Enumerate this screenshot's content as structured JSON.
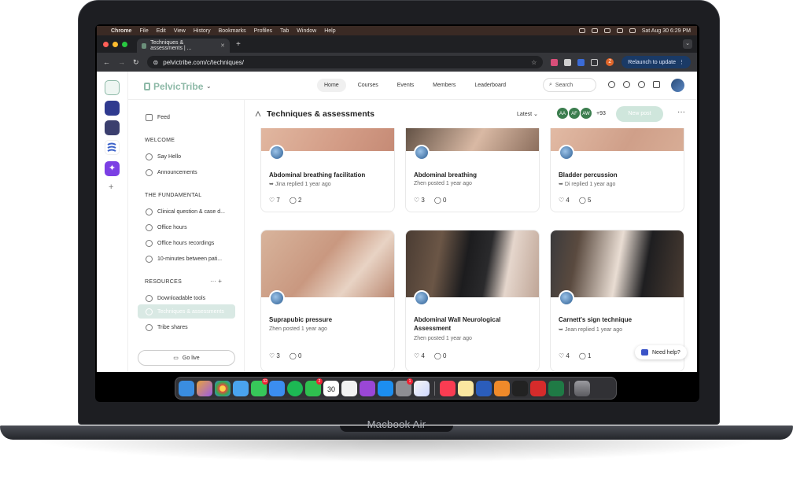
{
  "device": {
    "label": "Macbook Air"
  },
  "menubar": {
    "apple": "",
    "app": "Chrome",
    "items": [
      "File",
      "Edit",
      "View",
      "History",
      "Bookmarks",
      "Profiles",
      "Tab",
      "Window",
      "Help"
    ],
    "datetime": "Sat Aug 30  6:29 PM"
  },
  "browser": {
    "tab_title": "Techniques & assessments | ...",
    "new_tab": "+",
    "url": "pelvictribe.com/c/techniques/",
    "relaunch_label": "Relaunch to update",
    "profile_initial": "Z"
  },
  "app": {
    "brand": "PelvicTribe",
    "nav": [
      "Home",
      "Courses",
      "Events",
      "Members",
      "Leaderboard"
    ],
    "search_placeholder": "Search",
    "sidebar": {
      "feed": "Feed",
      "sections": [
        {
          "title": "WELCOME",
          "items": [
            "Say Hello",
            "Announcements"
          ]
        },
        {
          "title": "THE FUNDAMENTAL",
          "items": [
            "Clinical question & case d...",
            "Office hours",
            "Office hours recordings",
            "10-minutes between pati..."
          ]
        },
        {
          "title": "RESOURCES",
          "items": [
            "Downloadable tools",
            "Techniques & assessments",
            "Tribe shares"
          ]
        }
      ],
      "resources_actions": "···  +",
      "go_live": "Go live"
    },
    "space": {
      "title": "Techniques & assessments",
      "sort": "Latest",
      "members": [
        "AA",
        "AF",
        "AW"
      ],
      "more_members": "+93",
      "new_post": "New post",
      "more": "···"
    },
    "posts": [
      {
        "title": "Abdominal breathing facilitation",
        "meta": "Jina replied 1 year ago",
        "likes": "7",
        "comments": "2"
      },
      {
        "title": "Abdominal breathing",
        "meta": "Zhen posted 1 year ago",
        "likes": "3",
        "comments": "0"
      },
      {
        "title": "Bladder percussion",
        "meta": "Di replied 1 year ago",
        "likes": "4",
        "comments": "5"
      },
      {
        "title": "Suprapubic pressure",
        "meta": "Zhen posted 1 year ago",
        "likes": "3",
        "comments": "0"
      },
      {
        "title": "Abdominal Wall Neurological Assessment",
        "meta": "Zhen posted 1 year ago",
        "likes": "4",
        "comments": "0"
      },
      {
        "title": "Carnett's sign technique",
        "meta": "Jean replied 1 year ago",
        "likes": "4",
        "comments": "1"
      }
    ],
    "need_help": "Need help?"
  },
  "dock": {
    "badges": {
      "messages": "32",
      "facetime": "2",
      "calendar": "30",
      "settings": "1"
    }
  },
  "colors": {
    "accent": "#8db9a7",
    "active_bg": "#d9e9e4",
    "new_post_bg": "#cfe6dc",
    "menubar": "#3a2a24"
  }
}
